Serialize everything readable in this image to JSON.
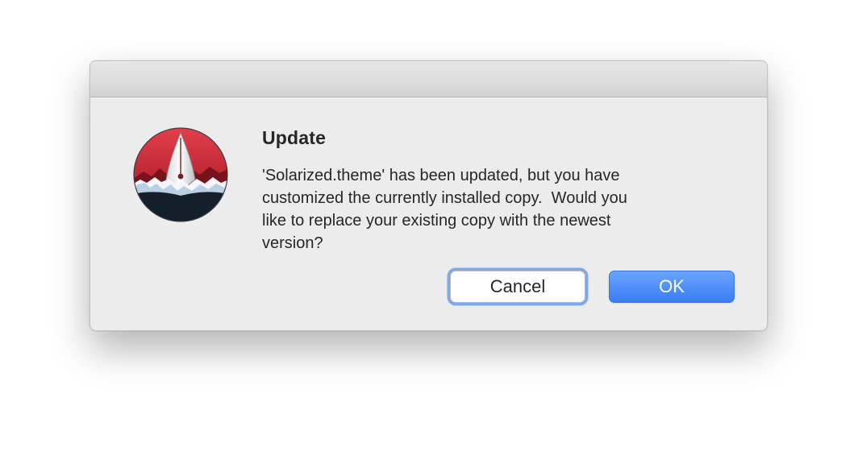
{
  "dialog": {
    "title": "Update",
    "message": "'Solarized.theme' has been updated, but you have\ncustomized the currently installed copy.  Would you\nlike to replace your existing copy with the newest\nversion?",
    "icon": "pen-nib-mountain-app-icon",
    "buttons": {
      "cancel_label": "Cancel",
      "ok_label": "OK"
    }
  },
  "colors": {
    "default_button": "#3a7ef6",
    "focus_ring": "#7fa8ea",
    "icon_red": "#c02a36",
    "icon_navy": "#141f2c"
  }
}
